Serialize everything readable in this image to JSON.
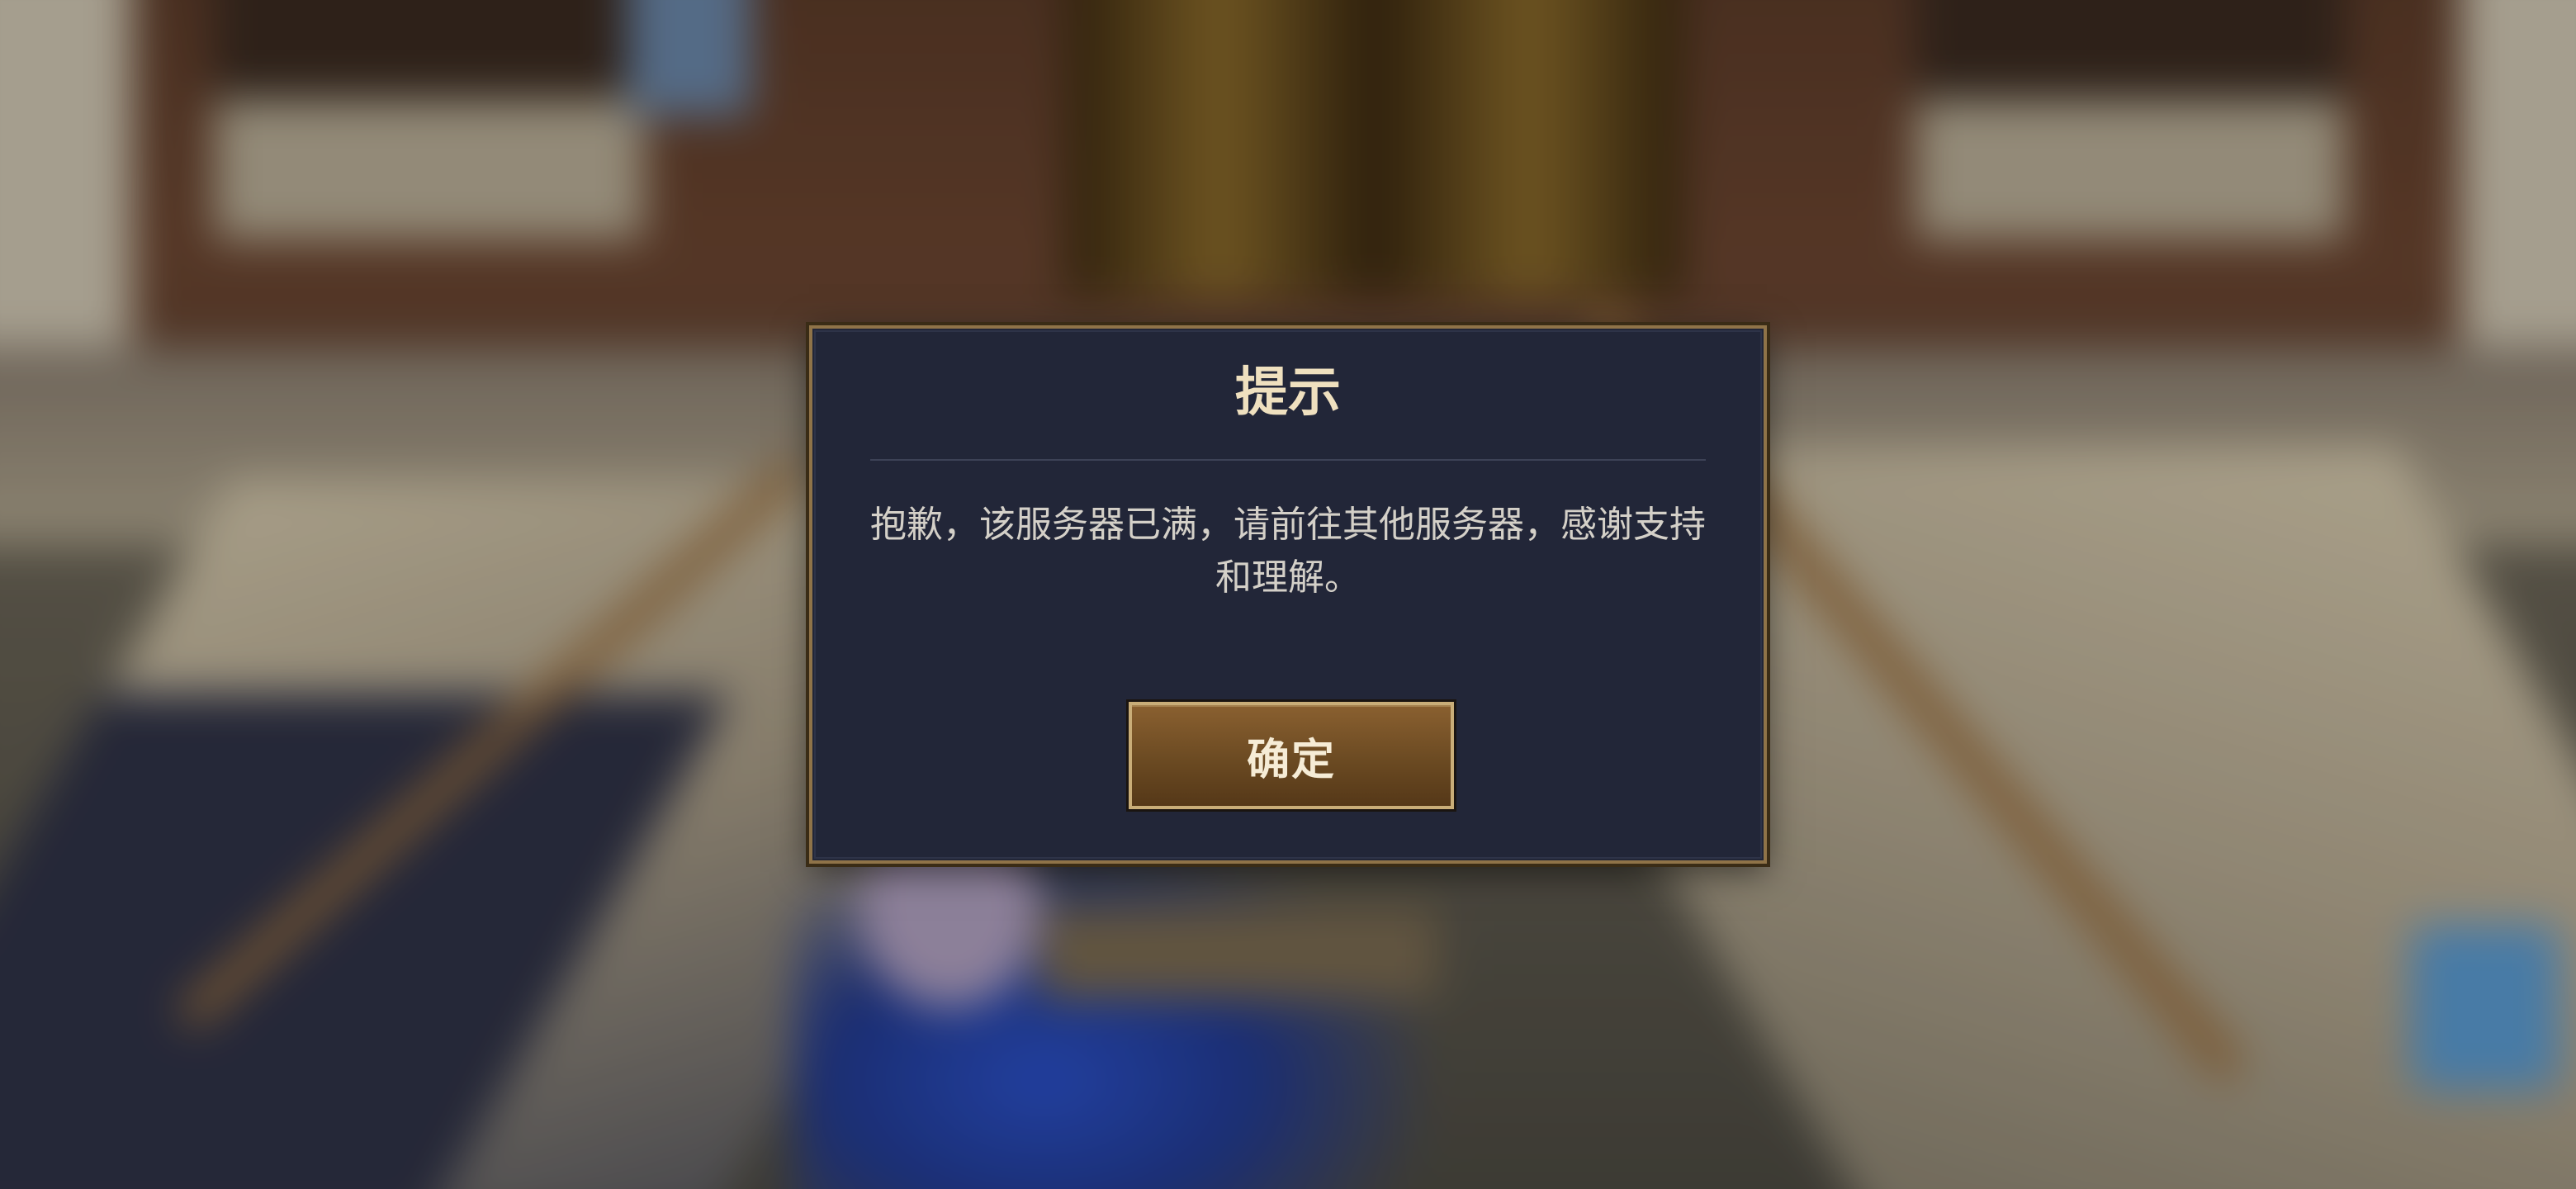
{
  "dialog": {
    "title": "提示",
    "message": "抱歉，该服务器已满，请前往其他服务器，感谢支持和理解。",
    "confirm_label": "确定"
  },
  "colors": {
    "dialog_background": "#222638",
    "dialog_border": "#8f7348",
    "title_text": "#efe0bf",
    "button_fill": "#6b4a22"
  }
}
